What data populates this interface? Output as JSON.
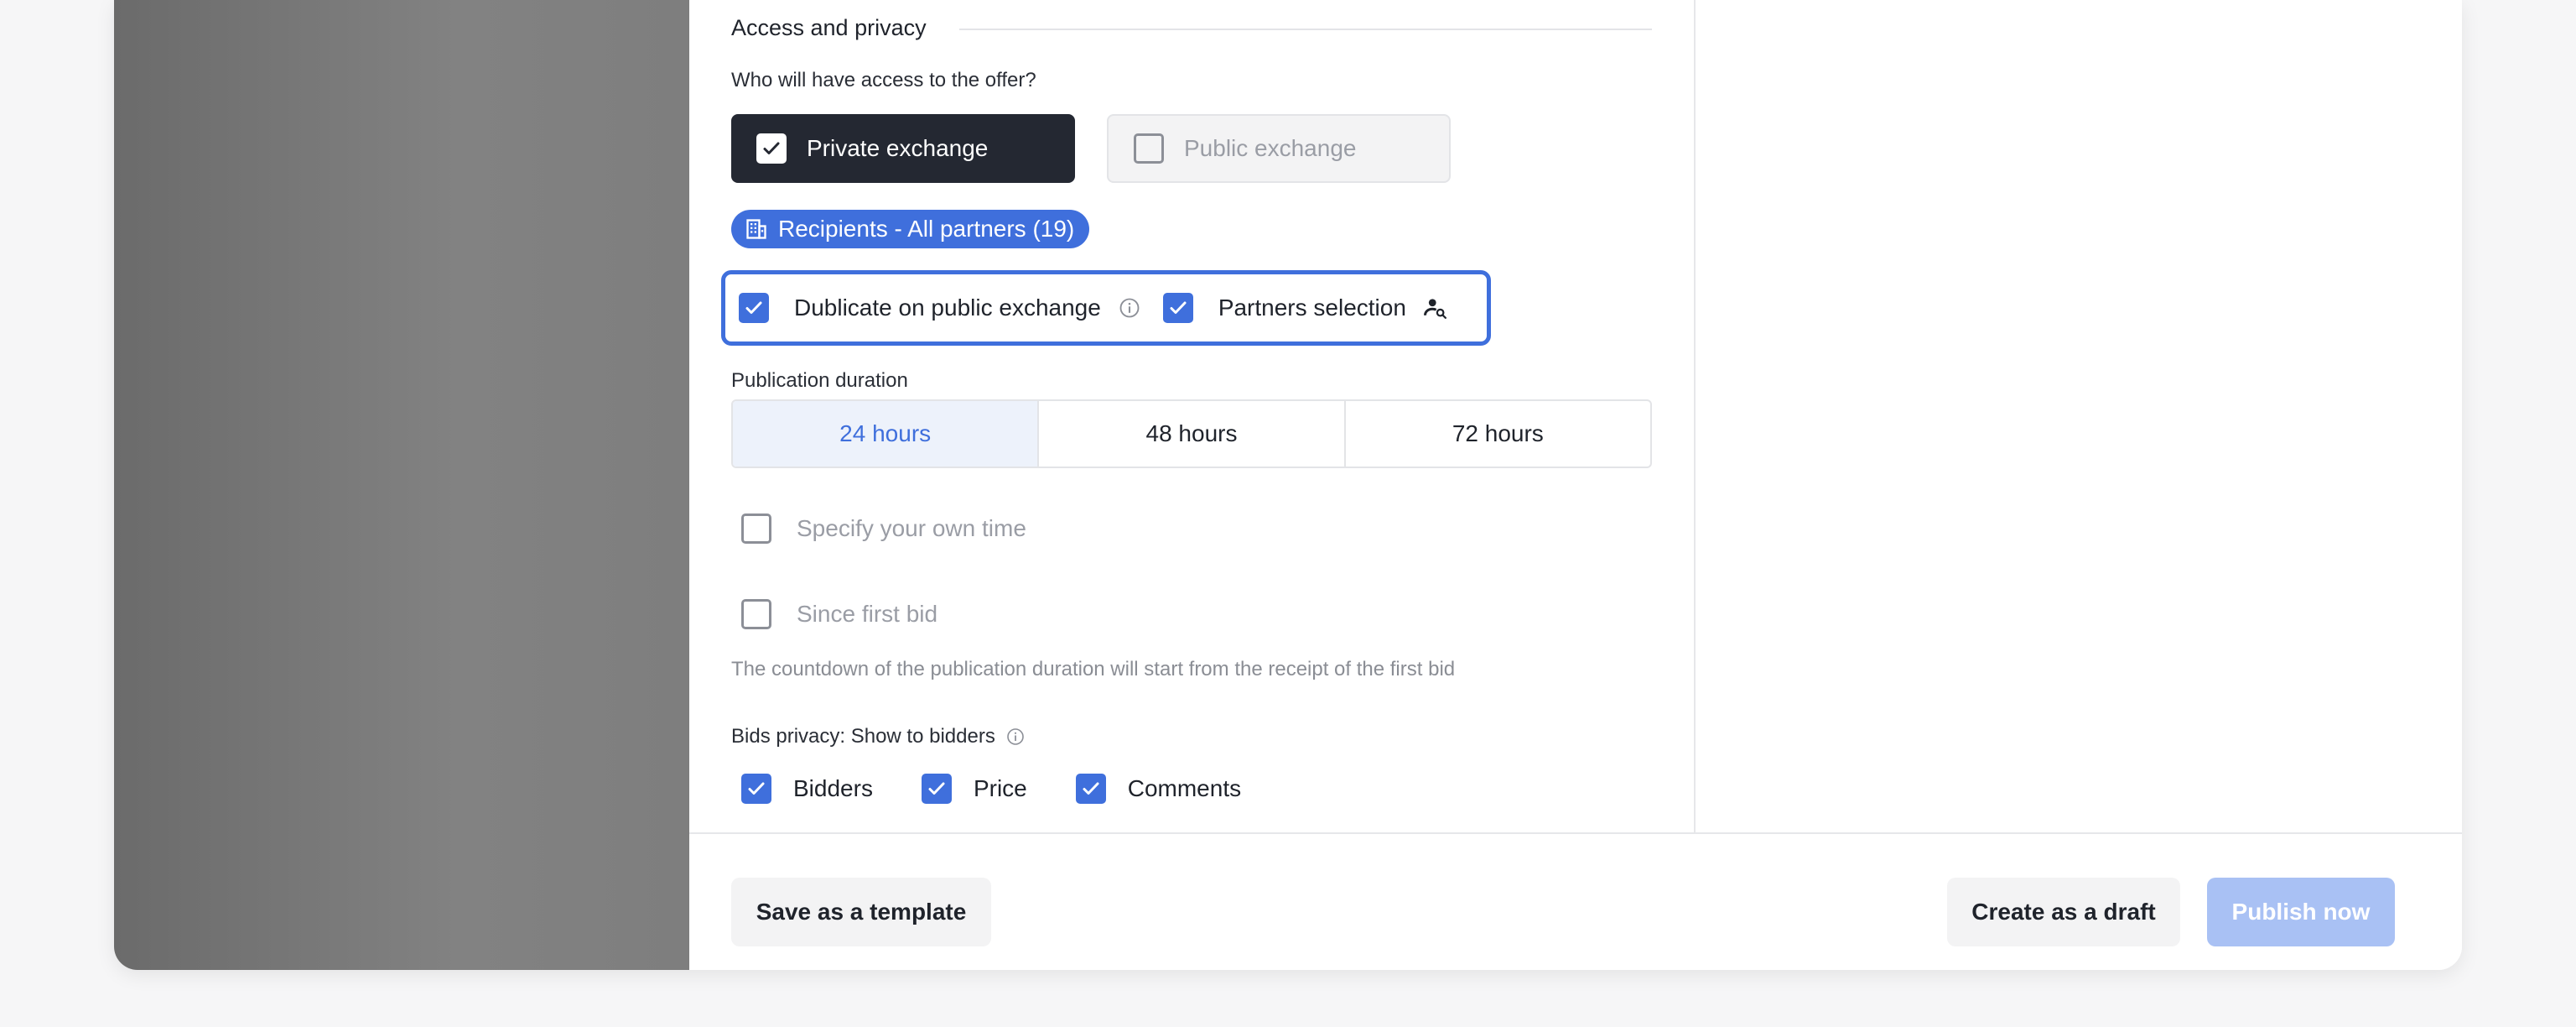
{
  "access": {
    "section_title": "Access and privacy",
    "question": "Who will have access to the offer?",
    "private_label": "Private exchange",
    "public_label": "Public exchange",
    "recipients_label": "Recipients - All partners (19)",
    "duplicate_label": "Dublicate on public exchange",
    "partners_label": "Partners selection"
  },
  "duration": {
    "label": "Publication duration",
    "options": [
      "24 hours",
      "48 hours",
      "72 hours"
    ],
    "selected": "24 hours",
    "own_time_label": "Specify your own time",
    "first_bid_label": "Since first bid",
    "first_bid_hint": "The countdown of the publication duration will start from the receipt of the first bid"
  },
  "bids_privacy": {
    "label": "Bids privacy: Show to bidders",
    "options": [
      "Bidders",
      "Price",
      "Comments"
    ]
  },
  "footer": {
    "template_label": "Save as a template",
    "draft_label": "Create as a draft",
    "publish_label": "Publish now"
  },
  "colors": {
    "accent": "#3f6fdc",
    "dark": "#242832",
    "publish_disabled": "#a9c1f4"
  },
  "icons": {
    "check": "check-icon",
    "building": "building-icon",
    "info": "info-icon",
    "person_search": "person-search-icon"
  }
}
